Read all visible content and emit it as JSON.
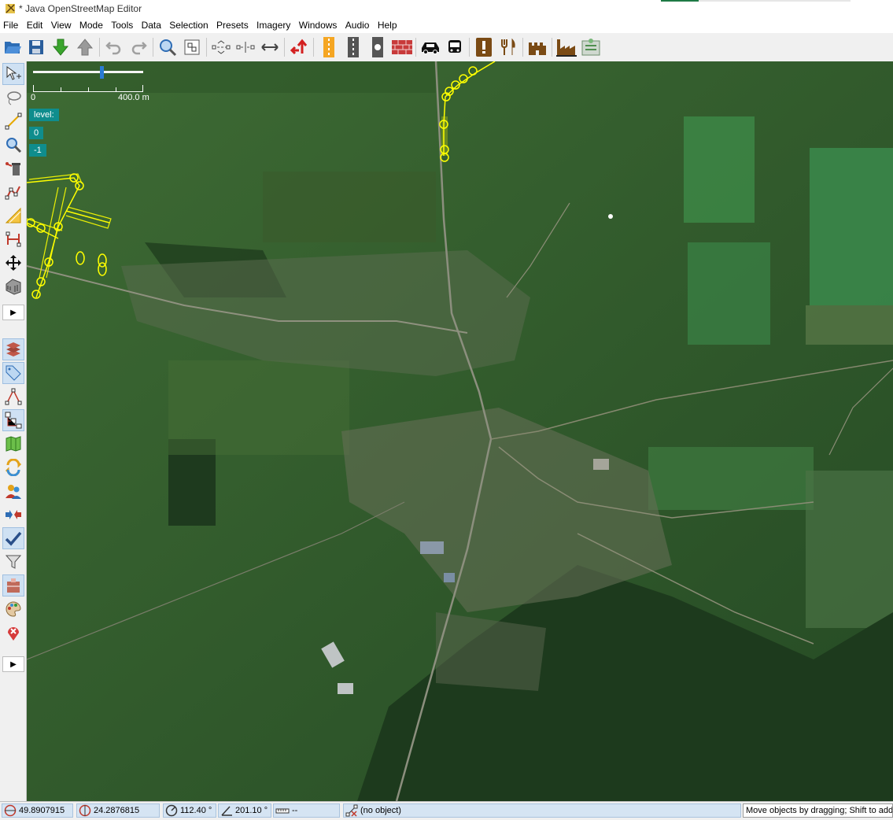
{
  "window": {
    "title": "* Java OpenStreetMap Editor"
  },
  "menu": [
    "File",
    "Edit",
    "View",
    "Mode",
    "Tools",
    "Data",
    "Selection",
    "Presets",
    "Imagery",
    "Windows",
    "Audio",
    "Help"
  ],
  "toolbar": {
    "icons": [
      "open-icon",
      "save-icon",
      "download-icon",
      "upload-icon",
      "undo-icon",
      "redo-icon",
      "zoom-icon",
      "zoom-to-selection-icon",
      "align-in-line-icon",
      "split-way-icon",
      "combine-way-icon",
      "reverse-way-icon",
      "road-yellow-icon",
      "road-grey-icon",
      "traffic-signals-icon",
      "wall-icon",
      "car-icon",
      "bus-icon",
      "warning-sign-icon",
      "restaurant-icon",
      "castle-icon",
      "factory-icon",
      "treatment-plant-icon"
    ]
  },
  "sidebar": {
    "tools": [
      "select-icon",
      "lasso-icon",
      "draw-icon",
      "zoom-icon",
      "delete-icon",
      "improve-way-icon",
      "parallel-way-icon",
      "extrude-icon",
      "move-icon",
      "building-icon"
    ],
    "panels": [
      "layers-icon",
      "tags-icon",
      "relation-editor-icon",
      "selection-list-icon",
      "map-paint-icon",
      "changeset-icon",
      "authors-icon",
      "conflict-icon",
      "validator-icon",
      "filter-icon",
      "presets-icon",
      "map-style-icon",
      "notes-icon"
    ],
    "more_label": "▶"
  },
  "map": {
    "scale": {
      "start_label": "0",
      "end_label": "400.0 m",
      "zoom_fraction": 0.61
    },
    "levels": {
      "title": "level:",
      "values": [
        "0",
        "-1"
      ]
    }
  },
  "status": {
    "latitude": "49.8907915",
    "longitude": "24.2876815",
    "heading": "112.40 °",
    "angle": "201.10 °",
    "distance": "--",
    "object": "(no object)",
    "help": "Move objects by dragging; Shift to add"
  },
  "colors": {
    "accent": "#1e7a45",
    "selection": "#ffff00",
    "level_button": "#0f8d8d",
    "status_field": "#d5e4f3"
  }
}
